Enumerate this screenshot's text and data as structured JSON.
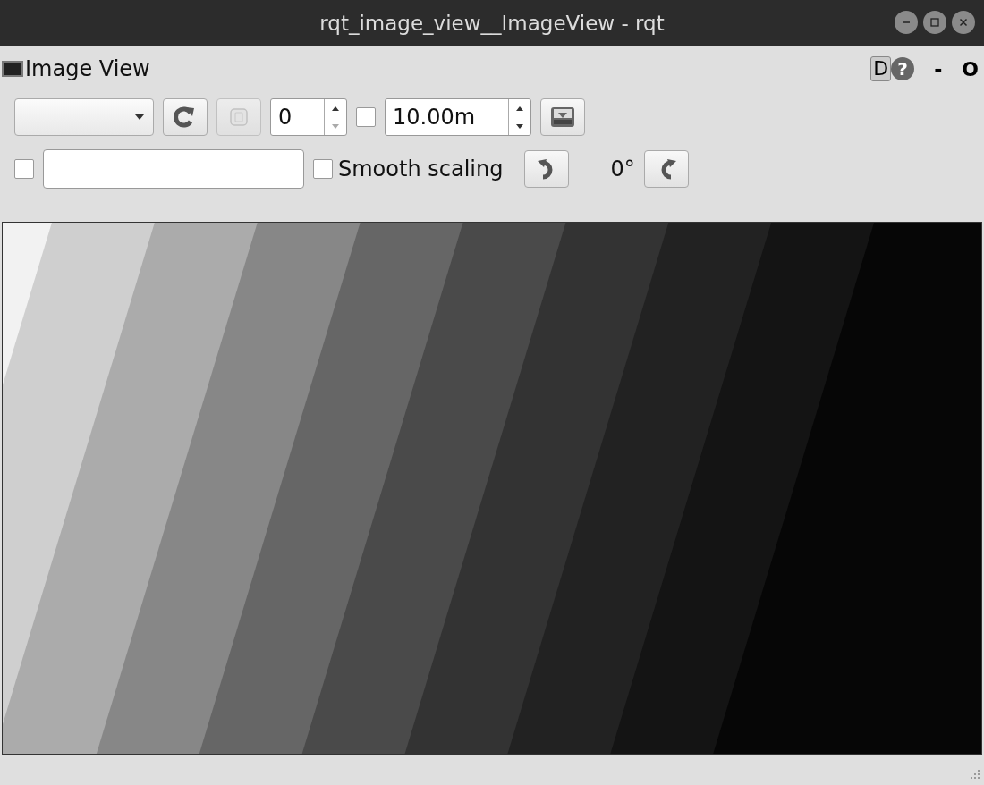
{
  "window": {
    "title": "rqt_image_view__ImageView - rqt"
  },
  "dock": {
    "title": "Image View",
    "buttons": [
      {
        "label": "D",
        "kind": "box"
      },
      {
        "label": "?",
        "kind": "help"
      },
      {
        "label": "-",
        "kind": "plain"
      },
      {
        "label": "O",
        "kind": "plain"
      }
    ]
  },
  "toolbar": {
    "refresh_disabled": false,
    "number_button_disabled": true,
    "index_spin": {
      "value": "0",
      "down_disabled": true,
      "up_disabled": false
    },
    "limit_checkbox": {
      "checked": false
    },
    "time_spin": {
      "value": "10.00m",
      "down_disabled": false,
      "up_disabled": false
    },
    "mouse_checkbox": {
      "checked": false
    },
    "smooth_scaling": {
      "label": "Smooth scaling",
      "checked": false
    },
    "rotation": "0°"
  }
}
